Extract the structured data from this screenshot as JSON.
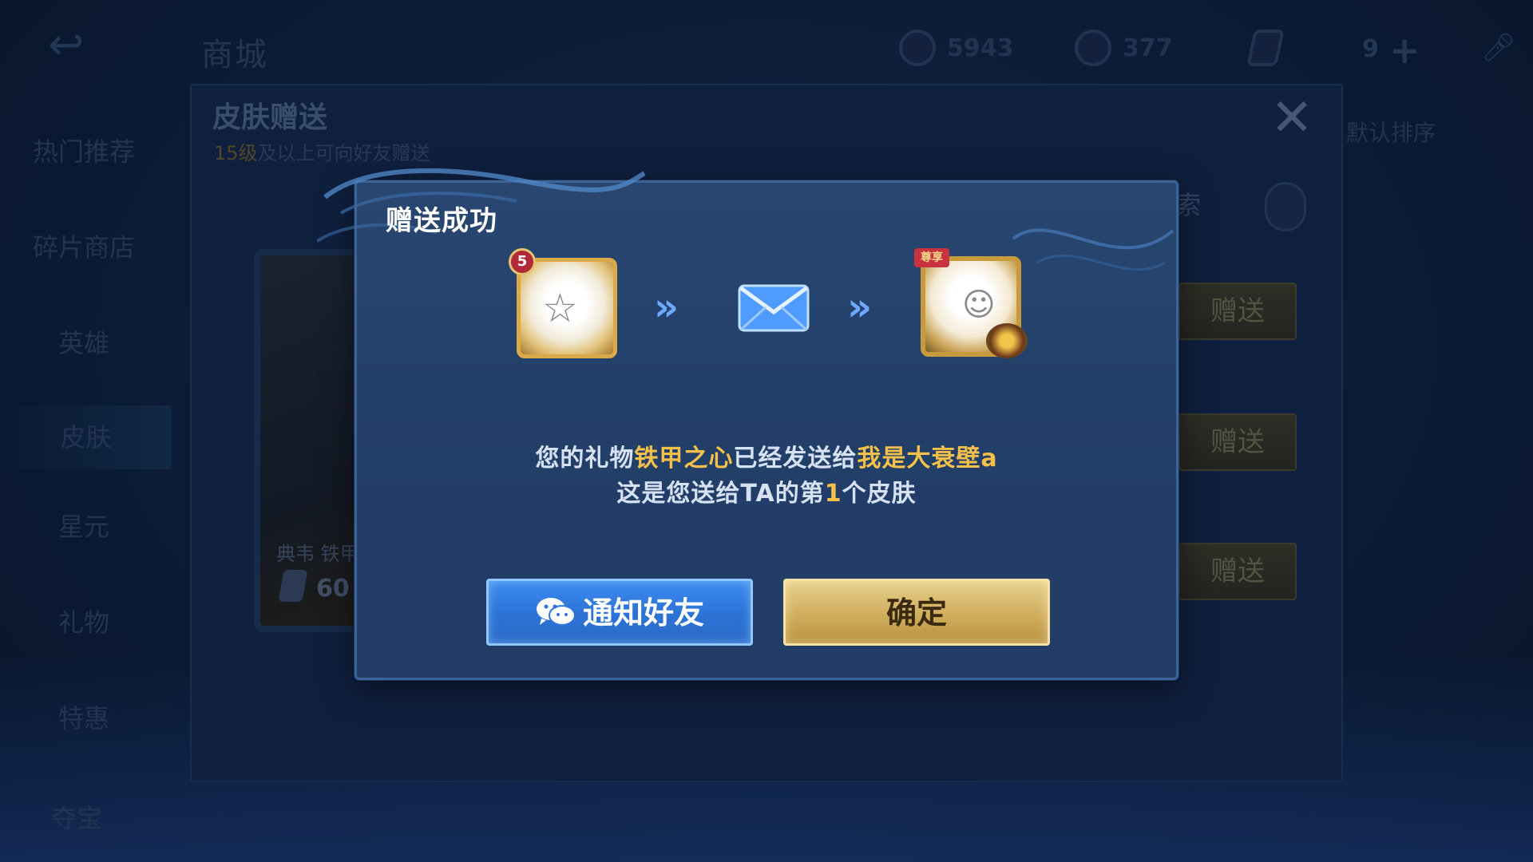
{
  "background": {
    "shop_title": "商城",
    "currency": [
      {
        "icon": "gold-coin-icon",
        "value": "5943"
      },
      {
        "icon": "diamond-icon",
        "value": "377"
      },
      {
        "icon": "voucher-icon",
        "value": ""
      }
    ],
    "level_value": "9",
    "sidebar": [
      "热门推荐",
      "碎片商店",
      "英雄",
      "皮肤",
      "星元",
      "礼物",
      "特惠",
      "夺宝"
    ],
    "gift_panel": {
      "title": "皮肤赠送",
      "subtitle_level": "15级",
      "subtitle_rest": "及以上可向好友赠送",
      "sort_label": "默认排序",
      "search_hint": "索",
      "gift_button_label": "赠送",
      "skin_card_name": "典韦 铁甲",
      "skin_card_price": "60"
    }
  },
  "modal": {
    "title": "赠送成功",
    "left_frame_level": "5",
    "right_frame_ribbon": "尊享",
    "message": {
      "prefix": "您的礼物",
      "gift_name": "铁甲之心",
      "middle": "已经发送给",
      "recipient": "我是大衰壁a",
      "line2_prefix": "这是您送给",
      "line2_target": "TA",
      "line2_mid": "的第",
      "count": "1",
      "line2_suffix": "个皮肤"
    },
    "notify_button": "通知好友",
    "confirm_button": "确定"
  },
  "colors": {
    "highlight": "#f4c049",
    "notify_button": "#2d74d8",
    "confirm_button": "#cfae5e"
  }
}
